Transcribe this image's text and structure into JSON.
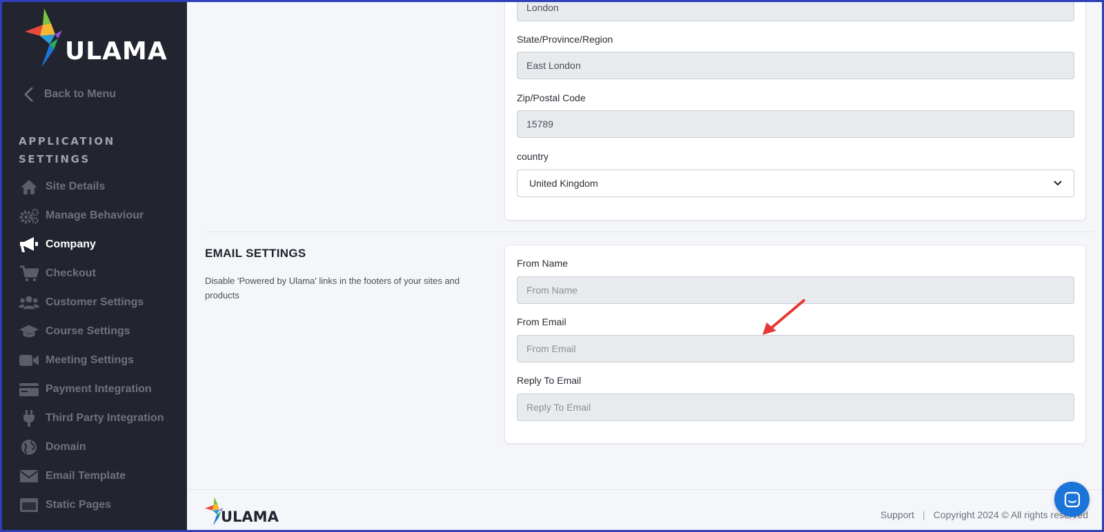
{
  "brand": {
    "name": "ULAMA"
  },
  "sidebar": {
    "back_label": "Back to Menu",
    "section_title": "APPLICATION SETTINGS",
    "items": [
      {
        "label": "Site Details",
        "icon": "home-icon"
      },
      {
        "label": "Manage Behaviour",
        "icon": "gears-icon"
      },
      {
        "label": "Company",
        "icon": "megaphone-icon",
        "active": true
      },
      {
        "label": "Checkout",
        "icon": "cart-icon"
      },
      {
        "label": "Customer Settings",
        "icon": "users-icon"
      },
      {
        "label": "Course Settings",
        "icon": "graduation-cap-icon"
      },
      {
        "label": "Meeting Settings",
        "icon": "video-icon"
      },
      {
        "label": "Payment Integration",
        "icon": "credit-card-icon"
      },
      {
        "label": "Third Party Integration",
        "icon": "plug-icon"
      },
      {
        "label": "Domain",
        "icon": "globe-icon"
      },
      {
        "label": "Email Template",
        "icon": "envelope-icon"
      },
      {
        "label": "Static Pages",
        "icon": "window-icon"
      }
    ]
  },
  "address": {
    "city_value": "London",
    "state_label": "State/Province/Region",
    "state_value": "East London",
    "zip_label": "Zip/Postal Code",
    "zip_value": "15789",
    "country_label": "country",
    "country_value": "United Kingdom"
  },
  "email_settings": {
    "title": "EMAIL SETTINGS",
    "description": "Disable 'Powered by Ulama' links in the footers of your sites and products",
    "from_name_label": "From Name",
    "from_name_placeholder": "From Name",
    "from_email_label": "From Email",
    "from_email_placeholder": "From Email",
    "reply_to_label": "Reply To Email",
    "reply_to_placeholder": "Reply To Email"
  },
  "footer": {
    "support_label": "Support",
    "separator": "|",
    "copyright": "Copyright 2024 © All rights reserved"
  },
  "colors": {
    "sidebar_bg": "#22252f",
    "accent_blue": "#1b74d8",
    "annotation_red": "#e53935"
  }
}
